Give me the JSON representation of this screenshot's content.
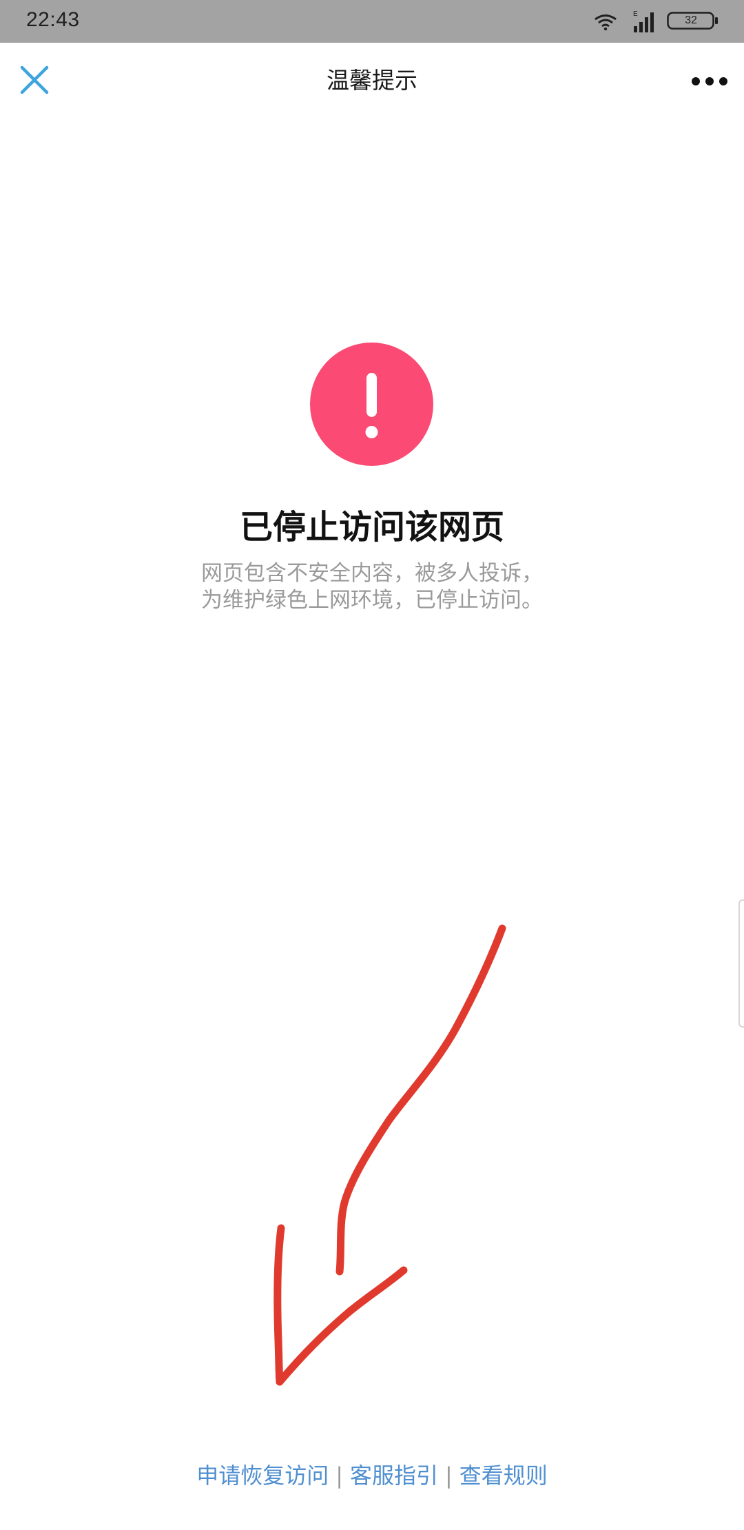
{
  "status_bar": {
    "time": "22:43",
    "battery": "32",
    "network_label": "E",
    "icons": [
      "wifi-icon",
      "signal-icon",
      "battery-icon"
    ]
  },
  "nav": {
    "title": "温馨提示",
    "close_icon": "close-icon",
    "more_icon": "more-dots-icon"
  },
  "warning": {
    "icon": "exclamation-icon",
    "icon_color": "#fb4a73",
    "title": "已停止访问该网页",
    "description_lines": [
      "网页包含不安全内容，被多人投诉，",
      "为维护绿色上网环境，已停止访问。"
    ]
  },
  "annotation": {
    "type": "hand-drawn arrow",
    "color": "#e03a2f"
  },
  "footer": {
    "links": [
      "申请恢复访问",
      "客服指引",
      "查看规则"
    ],
    "separator": "|",
    "link_color": "#4f8fd0"
  },
  "colors": {
    "accent": "#3da5dd",
    "status_bar_bg": "#a3a3a3"
  }
}
